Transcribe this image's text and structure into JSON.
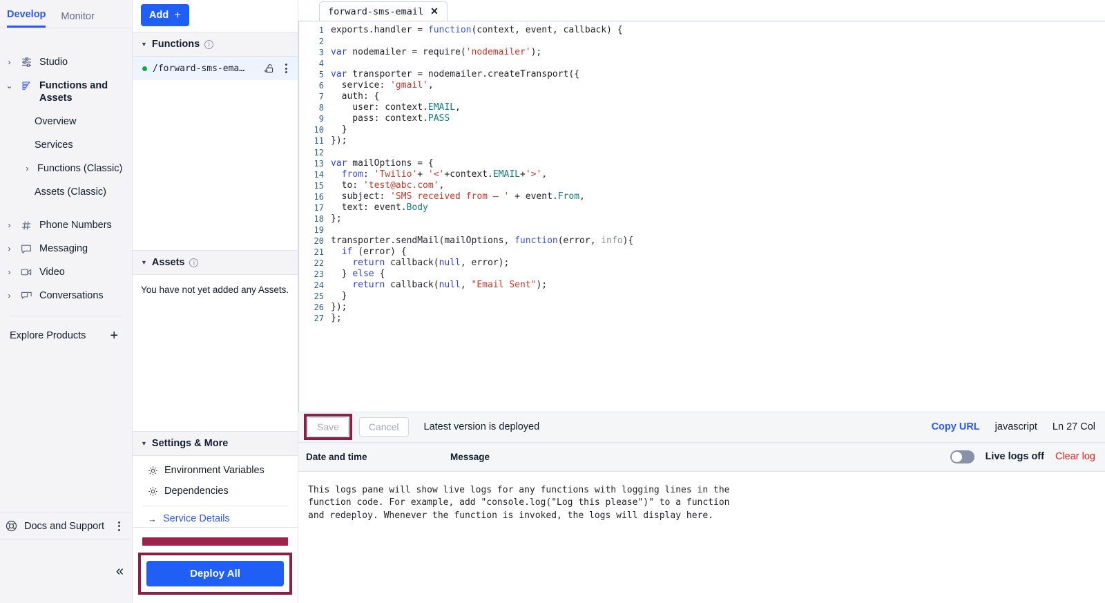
{
  "leftnav": {
    "tabs": [
      {
        "label": "Develop",
        "active": true
      },
      {
        "label": "Monitor",
        "active": false
      }
    ],
    "items": [
      {
        "label": "Studio",
        "icon": "studio-icon"
      },
      {
        "label": "Functions and Assets",
        "icon": "functions-icon"
      }
    ],
    "sub_items": [
      {
        "label": "Overview"
      },
      {
        "label": "Services"
      },
      {
        "label": "Functions (Classic)"
      },
      {
        "label": "Assets (Classic)"
      }
    ],
    "items2": [
      {
        "label": "Phone Numbers",
        "icon": "hash-icon"
      },
      {
        "label": "Messaging",
        "icon": "chat-icon"
      },
      {
        "label": "Video",
        "icon": "video-icon"
      },
      {
        "label": "Conversations",
        "icon": "conversations-icon"
      }
    ],
    "explore_products": "Explore Products",
    "docs_and_support": "Docs and Support",
    "collapse": "«"
  },
  "midpanel": {
    "add_button": "Add",
    "add_plus": "+",
    "functions_section": {
      "title": "Functions",
      "items": [
        {
          "name": "/forward-sms-ema…",
          "status": "deployed"
        }
      ]
    },
    "assets_section": {
      "title": "Assets",
      "empty_text": "You have not yet added any Assets."
    },
    "settings_section": {
      "title": "Settings & More",
      "items": [
        {
          "label": "Environment Variables",
          "icon": "gear-icon"
        },
        {
          "label": "Dependencies",
          "icon": "gear-icon"
        }
      ],
      "service_details": "Service Details"
    },
    "deploy_all": "Deploy All"
  },
  "editor": {
    "tab_name": "forward-sms-email",
    "tab_close": "✕",
    "lines": [
      {
        "n": "1",
        "html": "exports.handler = <span class=\"fn\">function</span>(context, event, callback) {"
      },
      {
        "n": "2",
        "html": ""
      },
      {
        "n": "3",
        "html": "<span class=\"kw\">var</span> nodemailer = require(<span class=\"str\">'nodemailer'</span>);"
      },
      {
        "n": "4",
        "html": ""
      },
      {
        "n": "5",
        "html": "<span class=\"kw\">var</span> transporter = nodemailer.createTransport({"
      },
      {
        "n": "6",
        "html": "  service: <span class=\"str\">'gmail'</span>,"
      },
      {
        "n": "7",
        "html": "  auth: {"
      },
      {
        "n": "8",
        "html": "    user: context.<span class=\"prop\">EMAIL</span>,"
      },
      {
        "n": "9",
        "html": "    pass: context.<span class=\"prop\">PASS</span>"
      },
      {
        "n": "10",
        "html": "  }"
      },
      {
        "n": "11",
        "html": "});"
      },
      {
        "n": "12",
        "html": ""
      },
      {
        "n": "13",
        "html": "<span class=\"kw\">var</span> mailOptions = {"
      },
      {
        "n": "14",
        "html": "  <span class=\"kw2\">from</span>: <span class=\"str\">'Twilio'</span>+ <span class=\"str\">'&lt;'</span>+context.<span class=\"prop\">EMAIL</span>+<span class=\"str\">'&gt;'</span>,"
      },
      {
        "n": "15",
        "html": "  to: <span class=\"str\">'test@abc.com'</span>,"
      },
      {
        "n": "16",
        "html": "  subject: <span class=\"str\">'SMS received from – '</span> + event.<span class=\"prop\">From</span>,"
      },
      {
        "n": "17",
        "html": "  text: event.<span class=\"prop\">Body</span>"
      },
      {
        "n": "18",
        "html": "};"
      },
      {
        "n": "19",
        "html": ""
      },
      {
        "n": "20",
        "html": "transporter.sendMail(mailOptions, <span class=\"fn\">function</span>(error, <span class=\"dim\">info</span>){"
      },
      {
        "n": "21",
        "html": "  <span class=\"kw\">if</span> (error) {"
      },
      {
        "n": "22",
        "html": "    <span class=\"kw\">return</span> callback(<span class=\"nul\">null</span>, error);"
      },
      {
        "n": "23",
        "html": "  } <span class=\"kw\">else</span> {"
      },
      {
        "n": "24",
        "html": "    <span class=\"kw\">return</span> callback(<span class=\"nul\">null</span>, <span class=\"str\">\"Email Sent\"</span>);"
      },
      {
        "n": "25",
        "html": "  }"
      },
      {
        "n": "26",
        "html": "});"
      },
      {
        "n": "27",
        "html": "};"
      }
    ]
  },
  "savebar": {
    "save": "Save",
    "cancel": "Cancel",
    "status": "Latest version is deployed",
    "copy_url": "Copy URL",
    "language": "javascript",
    "line_col": "Ln 27  Col"
  },
  "logs": {
    "col_date": "Date and time",
    "col_message": "Message",
    "live_logs_label": "Live logs off",
    "live_logs_on": false,
    "clear_logs": "Clear log",
    "placeholder": "This logs pane will show live logs for any functions with logging lines in the function code. For example, add \"console.log(\"Log this please\")\" to a function and redeploy. Whenever the function is invoked, the logs will display here."
  },
  "colors": {
    "accent_blue": "#1f5ff5",
    "link_blue": "#2c56f5",
    "annotation_maroon": "#8e1f44",
    "status_green": "#14a44d",
    "clear_red": "#e81f1f"
  }
}
